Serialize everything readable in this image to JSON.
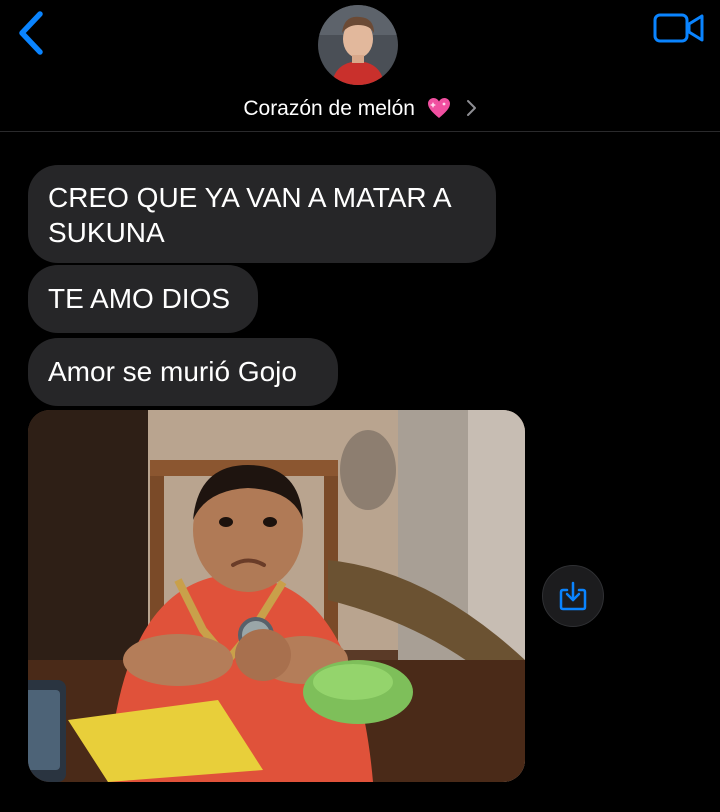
{
  "header": {
    "contact_name": "Corazón de melón",
    "back_icon": "chevron-left-icon",
    "video_icon": "video-camera-icon",
    "heart_icon": "sparkling-heart-emoji",
    "accent_color": "#0a84ff"
  },
  "messages": [
    {
      "text": "CREO QUE YA VAN A MATAR A SUKUNA"
    },
    {
      "text": "TE AMO DIOS"
    },
    {
      "text": "Amor se murió Gojo"
    }
  ],
  "attachment": {
    "type": "image",
    "save_icon": "save-to-photos-icon"
  },
  "colors": {
    "background": "#000000",
    "incoming_bubble": "#262628",
    "text": "#ffffff"
  }
}
